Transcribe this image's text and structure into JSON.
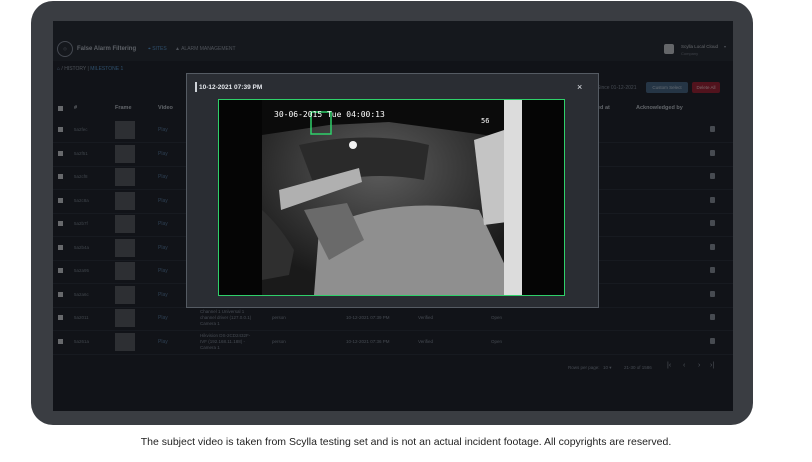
{
  "app": {
    "title": "False Alarm Filtering",
    "nav": [
      {
        "label": "SITES"
      },
      {
        "label": "ALARM MANAGEMENT"
      }
    ],
    "user": {
      "name": "Scylla Local Cloud",
      "subtitle": "Company"
    }
  },
  "breadcrumb": {
    "home": "⌂",
    "sep1": "/",
    "history": "HISTORY",
    "sep2": "|",
    "current": "MILESTONE 1"
  },
  "filters": {
    "since_text": "Since 01-12-2021",
    "custom_button": "Custom Select",
    "delete_button": "Delete All"
  },
  "table": {
    "headers": {
      "id": "#",
      "frame": "Frame",
      "video": "Video",
      "alerted_at": "ed at",
      "acknowledged_by": "Acknowledged by"
    },
    "rows": [
      {
        "id": "5a2fec",
        "play": "Play"
      },
      {
        "id": "5a2f51",
        "play": "Play"
      },
      {
        "id": "5a2cf8",
        "play": "Play"
      },
      {
        "id": "5a2c8a",
        "play": "Play"
      },
      {
        "id": "5a2b7f",
        "play": "Play"
      },
      {
        "id": "5a2b4a",
        "play": "Play"
      },
      {
        "id": "5a2a95",
        "play": "Play"
      },
      {
        "id": "5a2a6c",
        "play": "Play"
      },
      {
        "id": "5a2011",
        "play": "Play",
        "camera_l1": "Channel 1 Universal 1",
        "camera_l2": "channel driver (127.0.0.1)",
        "camera_l3": "Camera 1",
        "object": "person",
        "time": "10-12-2021 07:39 PM",
        "status": "Verified",
        "ack": "Open"
      },
      {
        "id": "5a261a",
        "play": "Play",
        "camera_l1": "Hikvision DS-2CD2432F-",
        "camera_l2": "IVF (192.168.11.188) -",
        "camera_l3": "Camera 1",
        "object": "person",
        "time": "10-12-2021 07:36 PM",
        "status": "Verified",
        "ack": "Open"
      }
    ]
  },
  "pagination": {
    "rows_label": "Rows per page:",
    "rows_value": "10 ▾",
    "range": "21-30 of 1586",
    "first": "|‹",
    "prev": "‹",
    "next": "›",
    "last": "›|"
  },
  "modal": {
    "title": "10-12-2021 07:39 PM",
    "close": "×",
    "overlay": {
      "timestamp": "30-06-2015 Tue 04:00:13",
      "channel": "56"
    }
  },
  "caption": "The subject video is taken from Scylla testing set and is not an actual incident footage. All copyrights are reserved.",
  "colors": {
    "accent": "#5b9bd5",
    "delete": "#a2263a",
    "detection_box": "#2fd06a",
    "background": "#222730"
  }
}
